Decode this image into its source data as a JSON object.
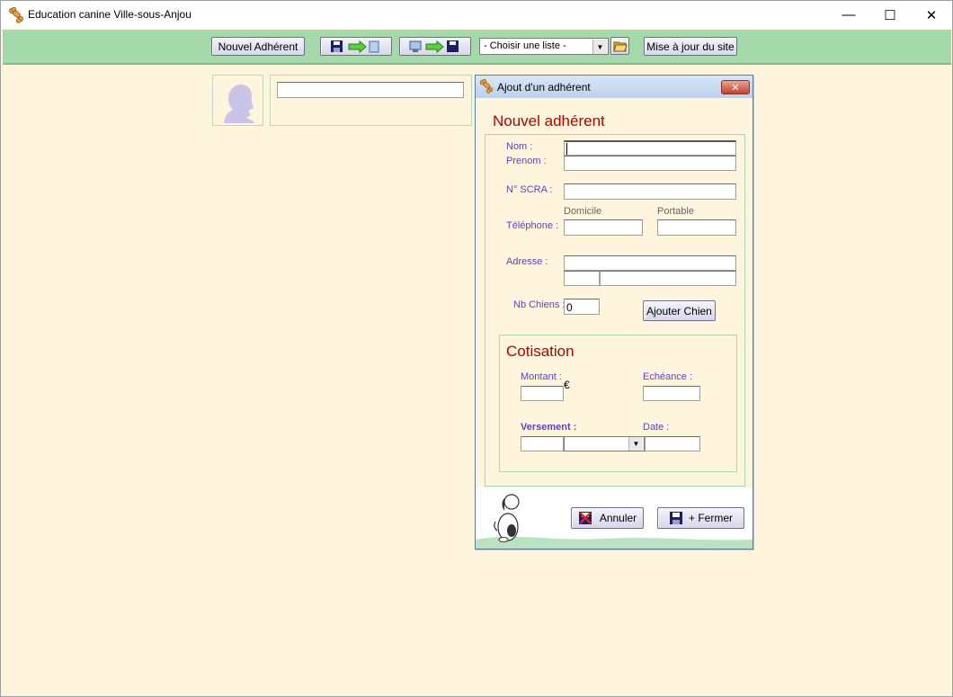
{
  "window": {
    "title": "Education canine Ville-sous-Anjou"
  },
  "window_controls": {
    "minimize": "—",
    "maximize": "☐",
    "close": "✕"
  },
  "toolbar": {
    "new_member_label": "Nouvel Adhérent",
    "list_select_value": "- Choisir une liste -",
    "update_site_label": "Mise à jour du site"
  },
  "search": {
    "value": ""
  },
  "dialog": {
    "title": "Ajout d'un adhérent",
    "close_glyph": "✕",
    "heading": "Nouvel adhérent",
    "labels": {
      "nom": "Nom :",
      "prenom": "Prenom :",
      "scra": "N° SCRA :",
      "domicile": "Domicile",
      "portable": "Portable",
      "telephone": "Téléphone :",
      "adresse": "Adresse :",
      "nb_chiens": "Nb Chiens :"
    },
    "values": {
      "nom": "",
      "prenom": "",
      "scra": "",
      "domicile": "",
      "portable": "",
      "adresse_1": "",
      "code_postal": "",
      "ville": "",
      "nb_chiens": "0"
    },
    "add_dog_label": "Ajouter Chien",
    "cotisation": {
      "heading": "Cotisation",
      "montant_label": "Montant :",
      "currency": "€",
      "echeance_label": "Echéance :",
      "versement_label": "Versement :",
      "date_label": "Date :",
      "montant_value": "",
      "echeance_value": "",
      "versement_value": "",
      "versement_mode": "",
      "date_value": ""
    },
    "cancel_label": "Annuler",
    "save_close_label": "+ Fermer"
  },
  "colors": {
    "background": "#fff5dc",
    "toolbar": "#a4d9a9",
    "label": "#5a3fd6",
    "heading": "#b40000"
  }
}
